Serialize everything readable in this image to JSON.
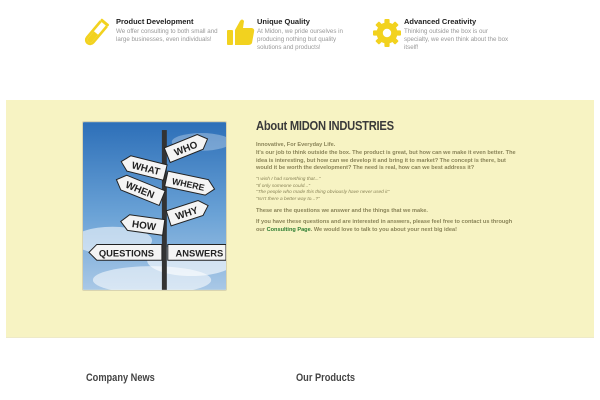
{
  "features": [
    {
      "title": "Product Development",
      "text": "We offer consulting to both small and large businesses, even individuals!",
      "icon": "test-tube-icon"
    },
    {
      "title": "Unique Quality",
      "text": "At Midon, we pride ourselves in producing nothing but quality solutions and products!",
      "icon": "thumbs-up-icon"
    },
    {
      "title": "Advanced Creativity",
      "text": "Thinking outside the box is our specialty, we even think about the box itself!",
      "icon": "gear-icon"
    }
  ],
  "about": {
    "title": "About MIDON INDUSTRIES",
    "intro_line1": "Innovative, For Everyday Life.",
    "intro_body": "It's our job to think outside the box.  The product is great, but how can we make it even better.  The idea is interesting, but how can we develop it and bring it to market?  The concept is there, but would it be worth the development?  The need is real, how can we best address it?",
    "quotes": [
      "\"I wish I had something that...\"",
      "\"If only someone could...\"",
      "\"The people who made this thing obviously have never used it\"",
      "\"Isn't there a better way to...?\""
    ],
    "mid_text": "These are the questions we answer and the things that we make.",
    "contact_before": "If you have these questions and are interested in answers, please feel free to contact us through our ",
    "contact_link": "Consulting Page",
    "contact_after": ". We would love to talk to you about your next big idea!",
    "signs": [
      "WHO",
      "WHAT",
      "WHERE",
      "WHEN",
      "WHY",
      "HOW",
      "QUESTIONS",
      "ANSWERS"
    ]
  },
  "footer": {
    "news_title": "Company News",
    "products_title": "Our Products"
  },
  "colors": {
    "accent_yellow": "#f2d21f",
    "about_bg": "#f7f3c3",
    "link_green": "#2e7d32"
  }
}
